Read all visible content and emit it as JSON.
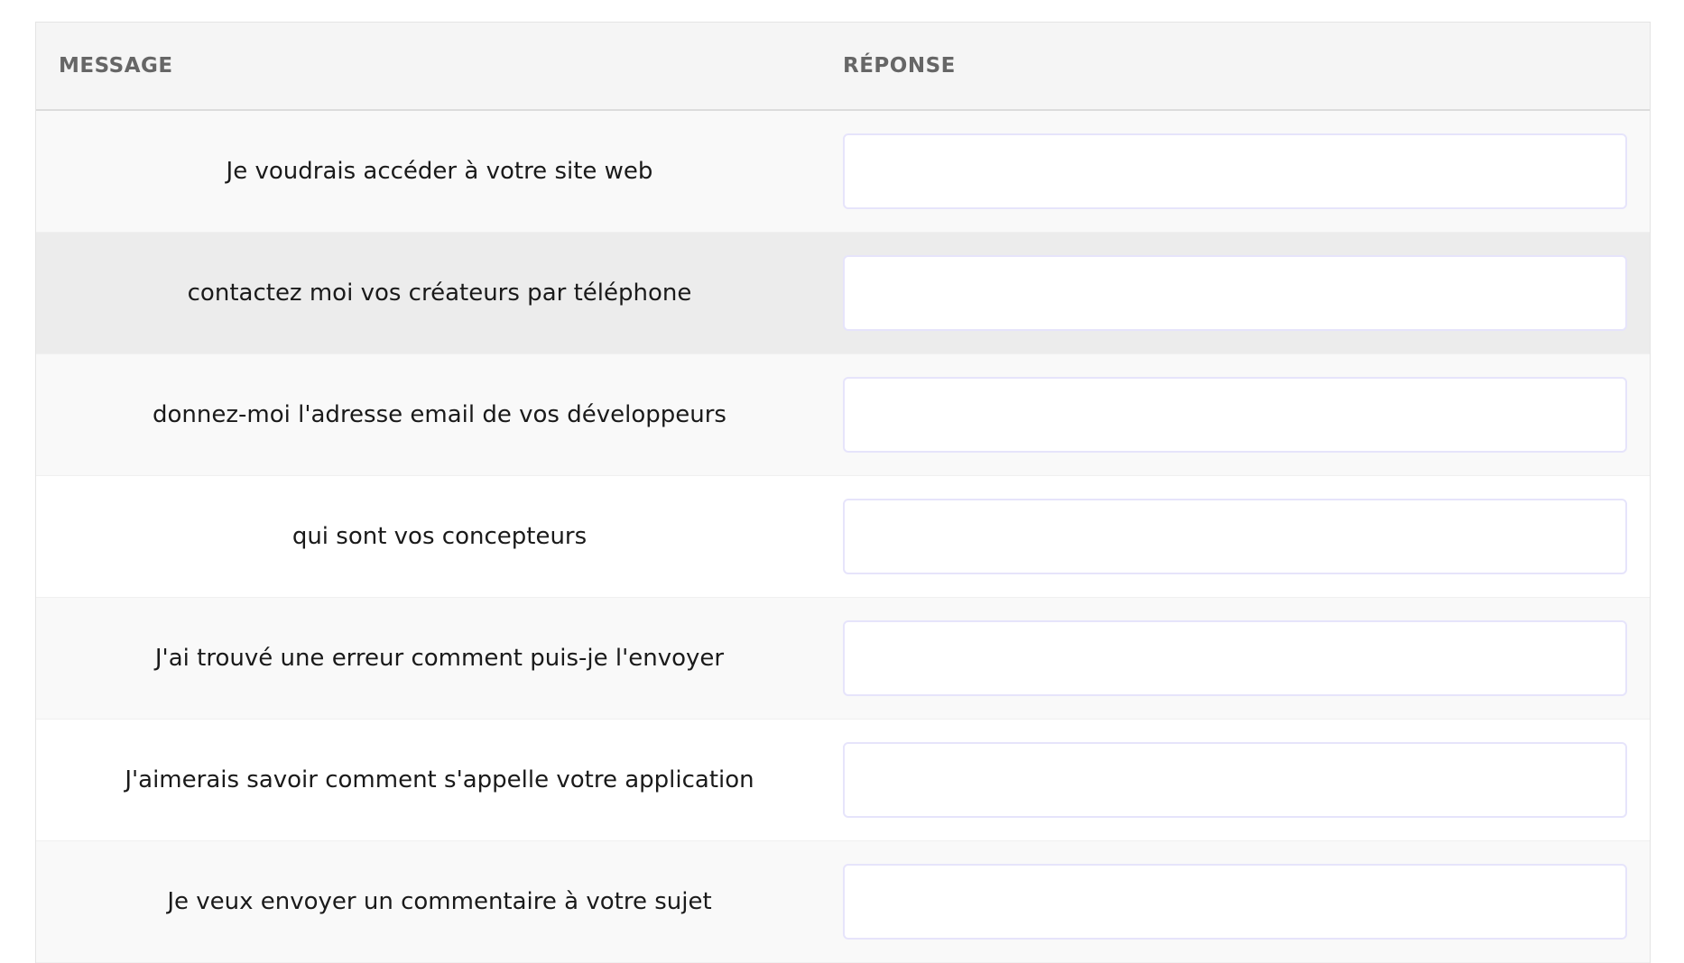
{
  "table": {
    "headers": {
      "message": "MESSAGE",
      "response": "RÉPONSE"
    },
    "rows": [
      {
        "message": "Je voudrais accéder à votre site web",
        "response": ""
      },
      {
        "message": "contactez moi vos créateurs par téléphone",
        "response": ""
      },
      {
        "message": "donnez-moi l'adresse email de vos développeurs",
        "response": ""
      },
      {
        "message": "qui sont vos concepteurs",
        "response": ""
      },
      {
        "message": "J'ai trouvé une erreur comment puis-je l'envoyer",
        "response": ""
      },
      {
        "message": "J'aimerais savoir comment s'appelle votre application",
        "response": ""
      },
      {
        "message": "Je veux envoyer un commentaire à votre sujet",
        "response": ""
      }
    ]
  }
}
